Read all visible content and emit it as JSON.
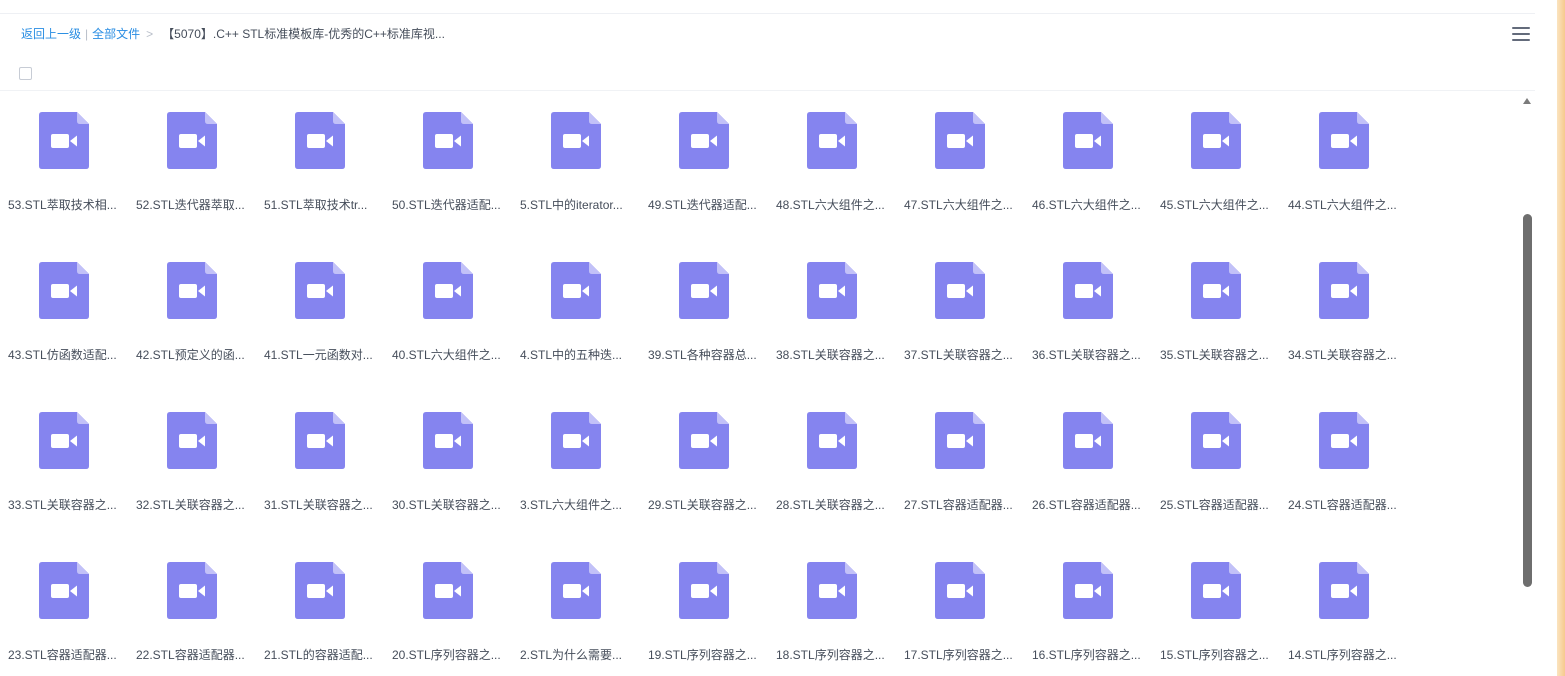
{
  "breadcrumb": {
    "back_label": "返回上一级",
    "sep": "|",
    "all_files_label": "全部文件",
    "gt": ">",
    "current": "【5070】.C++ STL标准模板库-优秀的C++标准库视..."
  },
  "colors": {
    "accent": "#2a8ee3",
    "video_icon": "#8584ef",
    "video_icon_fold": "#c2c1f8"
  },
  "icons": {
    "menu": "menu-icon",
    "file": "video-file-icon"
  },
  "files": [
    "53.STL萃取技术相...",
    "52.STL迭代器萃取...",
    "51.STL萃取技术tr...",
    "50.STL迭代器适配...",
    "5.STL中的iterator...",
    "49.STL迭代器适配...",
    "48.STL六大组件之...",
    "47.STL六大组件之...",
    "46.STL六大组件之...",
    "45.STL六大组件之...",
    "44.STL六大组件之...",
    "43.STL仿函数适配...",
    "42.STL预定义的函...",
    "41.STL一元函数对...",
    "40.STL六大组件之...",
    "4.STL中的五种迭...",
    "39.STL各种容器总...",
    "38.STL关联容器之...",
    "37.STL关联容器之...",
    "36.STL关联容器之...",
    "35.STL关联容器之...",
    "34.STL关联容器之...",
    "33.STL关联容器之...",
    "32.STL关联容器之...",
    "31.STL关联容器之...",
    "30.STL关联容器之...",
    "3.STL六大组件之...",
    "29.STL关联容器之...",
    "28.STL关联容器之...",
    "27.STL容器适配器...",
    "26.STL容器适配器...",
    "25.STL容器适配器...",
    "24.STL容器适配器...",
    "23.STL容器适配器...",
    "22.STL容器适配器...",
    "21.STL的容器适配...",
    "20.STL序列容器之...",
    "2.STL为什么需要...",
    "19.STL序列容器之...",
    "18.STL序列容器之...",
    "17.STL序列容器之...",
    "16.STL序列容器之...",
    "15.STL序列容器之...",
    "14.STL序列容器之..."
  ]
}
